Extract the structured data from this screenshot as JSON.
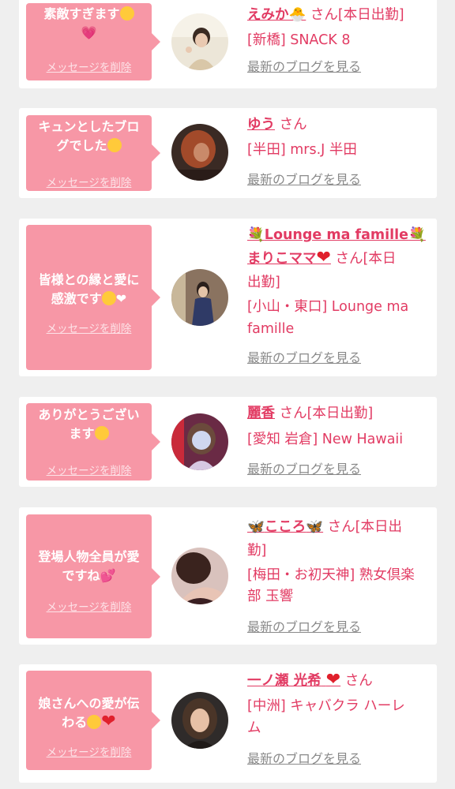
{
  "delete_label": "メッセージを削除",
  "blog_label": "最新のブログを見る",
  "colors": {
    "bubble": "#f797a6",
    "name": "#e23b63",
    "link_gray": "#8a8a8a",
    "background": "#efefef"
  },
  "cards": [
    {
      "message_lines": [
        "素敵すぎます",
        ""
      ],
      "message_emoji": [
        "relieved-face-emoji",
        "growing-heart-emoji"
      ],
      "name": "えみか",
      "name_emoji": "hatching-chick-emoji",
      "san": "さん",
      "line1_tail": "[本日出勤]",
      "shop": "[新橋] SNACK 8"
    },
    {
      "message_lines": [
        "キュンとしたブロ",
        "グでした"
      ],
      "message_emoji": [
        "heart-eyes-emoji"
      ],
      "name": "ゆう",
      "san": "さん",
      "shop": "[半田] mrs.J 半田"
    },
    {
      "message_lines": [
        "皆様との縁と愛に",
        "感激です"
      ],
      "message_emoji": [
        "relieved-face-emoji",
        "heart-emoji"
      ],
      "title": "Lounge ma famille",
      "title_emoji": "bouquet-emoji",
      "name": "まりこママ",
      "name_emoji": "red-heart-emoji",
      "san": "さん[本日",
      "line3": "出勤]",
      "shop1": "[小山・東口] Lounge ma",
      "shop2": "famille"
    },
    {
      "message_lines": [
        "ありがとうござい",
        "ます"
      ],
      "message_emoji": [
        "smiling-face-emoji"
      ],
      "name": "麗香",
      "san": "さん[本日出勤]",
      "shop": "[愛知 岩倉] New Hawaii"
    },
    {
      "message_lines": [
        "登場人物全員が愛",
        "ですね"
      ],
      "message_emoji": [
        "two-hearts-emoji"
      ],
      "name": "こころ",
      "name_emoji": "butterfly-emoji",
      "san": "さん[本日出",
      "line2": "勤]",
      "shop1": "[梅田・お初天神] 熟女倶楽",
      "shop2": "部 玉響"
    },
    {
      "message_lines": [
        "娘さんへの愛が伝",
        "わる"
      ],
      "message_emoji": [
        "pleading-face-emoji",
        "red-heart-emoji"
      ],
      "name": "一ノ瀬 光希",
      "name_emoji": "red-heart-emoji",
      "san": "さん",
      "shop1": "[中洲] キャバクラ ハーレ",
      "shop2": "ム"
    }
  ]
}
